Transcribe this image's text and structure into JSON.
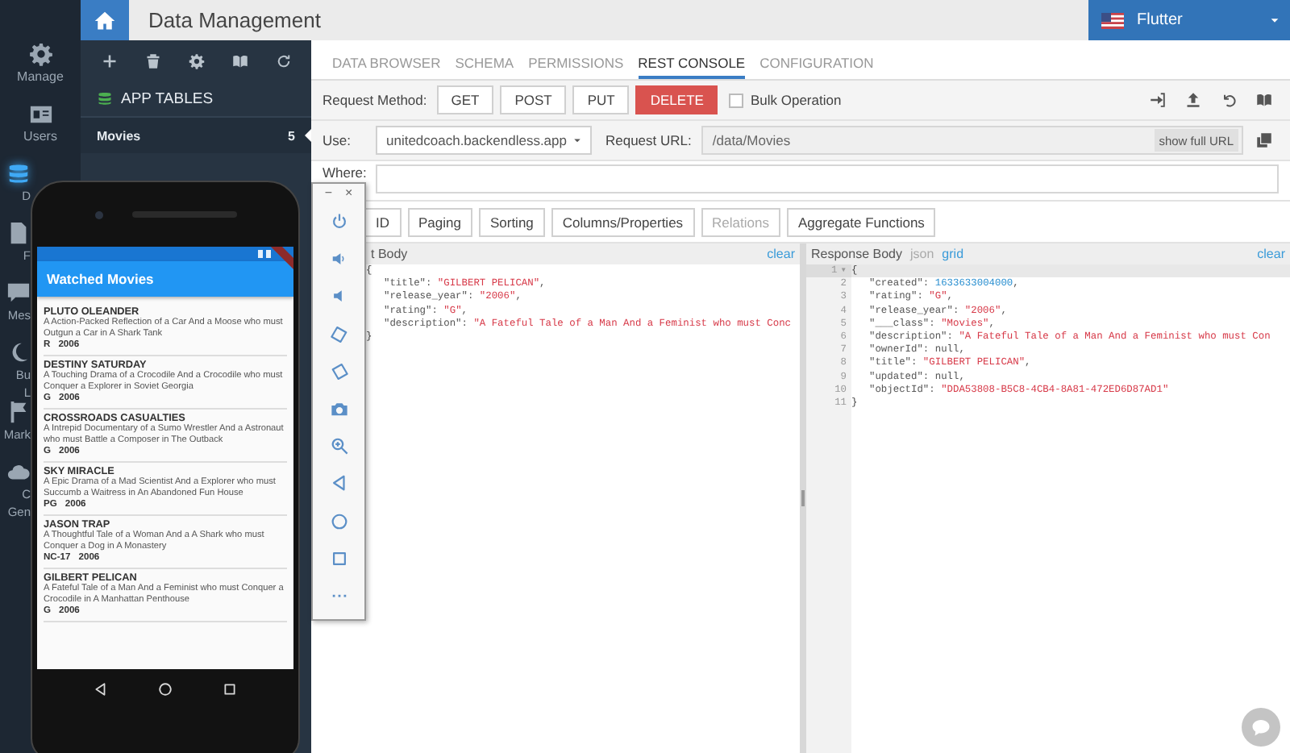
{
  "header": {
    "title": "Data Management",
    "app_name": "Flutter"
  },
  "nav": [
    {
      "kind": "gear",
      "label": "Manage",
      "selected": false
    },
    {
      "kind": "idcard",
      "label": "Users",
      "selected": false
    },
    {
      "kind": "database",
      "label": "D",
      "selected": true
    },
    {
      "kind": "file",
      "label": "F",
      "selected": false
    },
    {
      "kind": "message",
      "label": "Mes",
      "selected": false
    },
    {
      "kind": "halfmoon",
      "label": "Bu",
      "label_2": "L",
      "selected": false
    },
    {
      "kind": "flag",
      "label": "Mark",
      "selected": false
    },
    {
      "kind": "cloud",
      "label": "C",
      "label_2": "Gen",
      "selected": false
    }
  ],
  "tables": {
    "title": "APP TABLES",
    "items": [
      {
        "name": "Movies",
        "count": "5",
        "selected": true
      }
    ]
  },
  "console": {
    "tabs": [
      {
        "label": "DATA BROWSER",
        "selected": false
      },
      {
        "label": "SCHEMA",
        "selected": false
      },
      {
        "label": "PERMISSIONS",
        "selected": false
      },
      {
        "label": "REST CONSOLE",
        "selected": true
      },
      {
        "label": "CONFIGURATION",
        "selected": false
      }
    ],
    "request_method": {
      "label": "Request Method:",
      "methods": [
        {
          "label": "GET",
          "selected": false
        },
        {
          "label": "POST",
          "selected": false
        },
        {
          "label": "PUT",
          "selected": false
        },
        {
          "label": "DELETE",
          "selected": true
        }
      ]
    },
    "bulk_operation": {
      "label": "Bulk Operation",
      "checked": false
    },
    "use": {
      "label": "Use:",
      "value": "unitedcoach.backendless.app"
    },
    "request_url": {
      "label": "Request URL:",
      "value": "/data/Movies",
      "button": "show full URL"
    },
    "where": {
      "label": "Where:"
    },
    "options": [
      {
        "label": "ID",
        "disabled": false
      },
      {
        "label": "Paging",
        "disabled": false
      },
      {
        "label": "Sorting",
        "disabled": false
      },
      {
        "label": "Columns/Properties",
        "disabled": false
      },
      {
        "label": "Relations",
        "disabled": true
      },
      {
        "label": "Aggregate Functions",
        "disabled": false
      }
    ],
    "request_body": {
      "title": "t Body",
      "clear": "clear",
      "lines": [
        {
          "kind": "brace",
          "text": "{"
        },
        {
          "kind": "string",
          "key": "\"title\": ",
          "value": "\"GILBERT PELICAN\"",
          "tail": ","
        },
        {
          "kind": "string",
          "key": "\"release_year\": ",
          "value": "\"2006\"",
          "tail": ","
        },
        {
          "kind": "string",
          "key": "\"rating\": ",
          "value": "\"G\"",
          "tail": ","
        },
        {
          "kind": "string",
          "key": "\"description\": ",
          "value": "\"A Fateful Tale of a Man And a Feminist who must Conc"
        },
        {
          "kind": "brace",
          "text": "}"
        }
      ]
    },
    "response_body": {
      "title": "Response Body",
      "views": [
        {
          "label": "json",
          "selected": true
        },
        {
          "label": "grid",
          "selected": false
        }
      ],
      "clear": "clear",
      "lines": [
        {
          "number": "1",
          "fold": "▾",
          "active": true,
          "kind": "brace",
          "text": "{"
        },
        {
          "number": "2",
          "active": false,
          "kind": "number",
          "key": "\"created\": ",
          "value": "1633633004000",
          "tail": ","
        },
        {
          "number": "3",
          "active": false,
          "kind": "string",
          "key": "\"rating\": ",
          "value": "\"G\"",
          "tail": ","
        },
        {
          "number": "4",
          "active": false,
          "kind": "string",
          "key": "\"release_year\": ",
          "value": "\"2006\"",
          "tail": ","
        },
        {
          "number": "5",
          "active": false,
          "kind": "string",
          "key": "\"___class\": ",
          "value": "\"Movies\"",
          "tail": ","
        },
        {
          "number": "6",
          "active": false,
          "kind": "string",
          "key": "\"description\": ",
          "value": "\"A Fateful Tale of a Man And a Feminist who must Con"
        },
        {
          "number": "7",
          "active": false,
          "kind": "null",
          "key": "\"ownerId\": ",
          "value": "null",
          "tail": ","
        },
        {
          "number": "8",
          "active": false,
          "kind": "string",
          "key": "\"title\": ",
          "value": "\"GILBERT PELICAN\"",
          "tail": ","
        },
        {
          "number": "9",
          "active": false,
          "kind": "null",
          "key": "\"updated\": ",
          "value": "null",
          "tail": ","
        },
        {
          "number": "10",
          "active": false,
          "kind": "string",
          "key": "\"objectId\": ",
          "value": "\"DDA53808-B5C8-4CB4-8A81-472ED6D87AD1\""
        },
        {
          "number": "11",
          "active": false,
          "kind": "brace",
          "text": "}"
        }
      ]
    }
  },
  "emulator": {
    "window_controls": [
      "−",
      "×"
    ],
    "app_title": "Watched Movies",
    "movies": [
      {
        "title": "PLUTO OLEANDER",
        "description": "A Action-Packed Reflection of a Car And a Moose who must Outgun a Car in A Shark Tank",
        "rating": "R",
        "year": "2006"
      },
      {
        "title": "DESTINY SATURDAY",
        "description": "A Touching Drama of a Crocodile And a Crocodile who must Conquer a Explorer in Soviet Georgia",
        "rating": "G",
        "year": "2006"
      },
      {
        "title": "CROSSROADS CASUALTIES",
        "description": "A Intrepid Documentary of a Sumo Wrestler And a Astronaut who must Battle a Composer in The Outback",
        "rating": "G",
        "year": "2006"
      },
      {
        "title": "SKY MIRACLE",
        "description": "A Epic Drama of a Mad Scientist And a Explorer who must Succumb a Waitress in An Abandoned Fun House",
        "rating": "PG",
        "year": "2006"
      },
      {
        "title": "JASON TRAP",
        "description": "A Thoughtful Tale of a Woman And a A Shark who must Conquer a Dog in A Monastery",
        "rating": "NC-17",
        "year": "2006"
      },
      {
        "title": "GILBERT PELICAN",
        "description": "A Fateful Tale of a Man And a Feminist who must Conquer a Crocodile in A Manhattan Penthouse",
        "rating": "G",
        "year": "2006"
      }
    ]
  }
}
